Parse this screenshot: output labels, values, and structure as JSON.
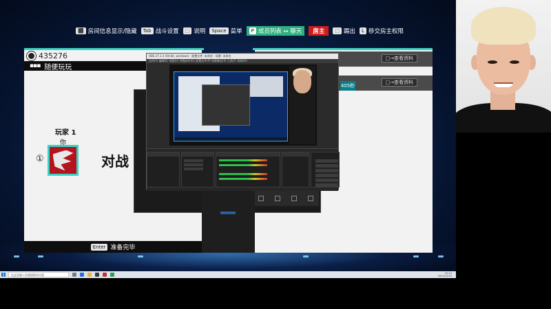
{
  "hint_bar": {
    "room_info": {
      "key": "⬛",
      "label": "房间信息显示/隐藏"
    },
    "tactics": {
      "key": "Tab",
      "label": "战斗设置"
    },
    "help": {
      "key": "⬚",
      "label": "说明"
    },
    "menu": {
      "key": "Space",
      "label": "菜单"
    },
    "members": {
      "key": "P",
      "label": "成员列表 ↔ 聊天"
    },
    "host_badge": "房主",
    "kick": {
      "key": "⬚",
      "label": "踢出"
    },
    "transfer": {
      "key": "L",
      "label": "移交房主权限"
    }
  },
  "left_panel": {
    "room_id": "435276",
    "mode": "随便玩玩",
    "mode_icon": "▪▪▪",
    "player_label": "玩家 1",
    "player_you": "你",
    "slot_number": "①",
    "vs_text": "对战",
    "ready_key": "Enter",
    "ready_label": "准备完毕"
  },
  "right_panel": {
    "view_profile_1": "□→查看资料",
    "view_profile_2": "□→查看资料",
    "time_label": "405秒"
  },
  "obs": {
    "title": "OBS 27.1.3 (64-bit, windows) - 配置文件: 未命名 - 场景: 未命名",
    "menu": "文件(F) 编辑(E) 视图(V) 停靠部件(D) 配置文件(P) 场景集合(S) 工具(T) 帮助(H)"
  },
  "taskbar": {
    "search_placeholder": "在这里输入你要搜索的内容",
    "tray_time": "22:14",
    "tray_date": "2021/12/24"
  },
  "colors": {
    "accent_teal": "#3ad6c8",
    "host_red": "#d11b1b",
    "members_green": "#2fb07f",
    "team_red": "#b3141e"
  }
}
